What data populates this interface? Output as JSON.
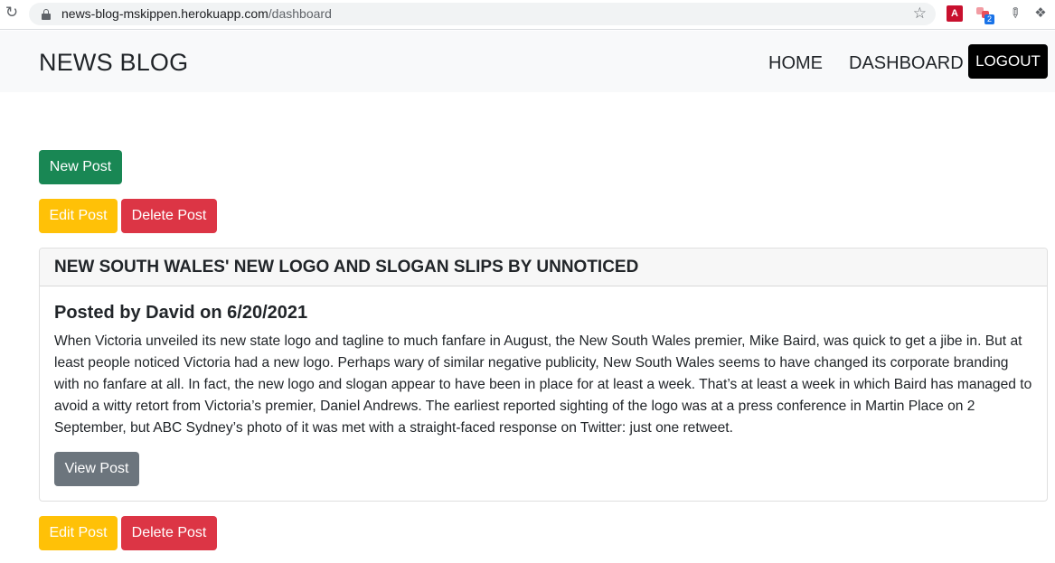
{
  "browser": {
    "reload_icon": "reload-icon",
    "url_host": "news-blog-mskippen.herokuapp.com",
    "url_path": "/dashboard",
    "pdf_ext_label": "A",
    "ext_badge": "2"
  },
  "navbar": {
    "brand": "NEWS BLOG",
    "home": "HOME",
    "dashboard": "DASHBOARD",
    "logout": "LOGOUT"
  },
  "actions": {
    "new_post": "New Post",
    "edit_post": "Edit Post",
    "delete_post": "Delete Post"
  },
  "post": {
    "title": "NEW SOUTH WALES' NEW LOGO AND SLOGAN SLIPS BY UNNOTICED",
    "byline": "Posted by David on 6/20/2021",
    "body": "When Victoria unveiled its new state logo and tagline to much fanfare in August, the New South Wales premier, Mike Baird, was quick to get a jibe in. But at least people noticed Victoria had a new logo. Perhaps wary of similar negative publicity, New South Wales seems to have changed its corporate branding with no fanfare at all. In fact, the new logo and slogan appear to have been in place for at least a week. That’s at least a week in which Baird has managed to avoid a witty retort from Victoria’s premier, Daniel Andrews. The earliest reported sighting of the logo was at a press conference in Martin Place on 2 September, but ABC Sydney’s photo of it was met with a straight-faced response on Twitter: just one retweet.",
    "view_post": "View Post",
    "edit_post": "Edit Post",
    "delete_post": "Delete Post"
  },
  "colors": {
    "success": "#198754",
    "warning": "#ffc107",
    "danger": "#dc3545",
    "secondary": "#6c757d",
    "logout_bg": "#000000"
  }
}
